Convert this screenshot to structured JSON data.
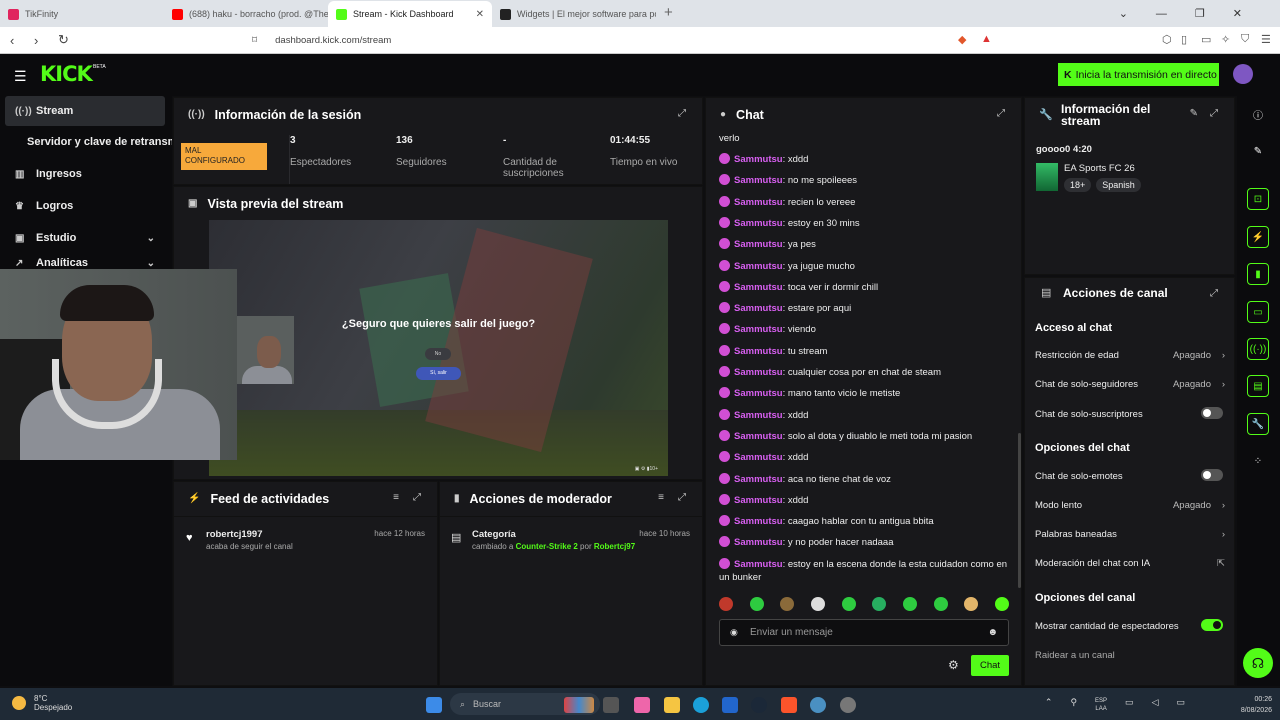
{
  "browser": {
    "tabs": [
      {
        "title": "TikFinity",
        "color": "#e0245e",
        "active": false
      },
      {
        "title": "(688) haku - borracho (prod. @Theo",
        "color": "#ff0000",
        "active": false
      },
      {
        "title": "Stream - Kick Dashboard",
        "color": "#53fc18",
        "active": true
      },
      {
        "title": "Widgets | El mejor software para po",
        "color": "#222222",
        "active": false
      }
    ],
    "url": "dashboard.kick.com/stream"
  },
  "header": {
    "logo": "KICK",
    "beta": "BETA",
    "go_live": "Inicia la transmisión en directo"
  },
  "sidebar": {
    "items": [
      {
        "label": "Stream",
        "icon": "broadcast-icon"
      },
      {
        "label": "Servidor y clave de retransm",
        "icon": ""
      },
      {
        "label": "Ingresos",
        "icon": "chart-icon"
      },
      {
        "label": "Logros",
        "icon": "trophy-icon"
      },
      {
        "label": "Estudio",
        "icon": "studio-icon"
      },
      {
        "label": "Analíticas",
        "icon": "analytics-icon"
      }
    ]
  },
  "session": {
    "title": "Información de la sesión",
    "badge": "MAL CONFIGURADO",
    "stats": [
      {
        "value": "3",
        "label": "Espectadores"
      },
      {
        "value": "136",
        "label": "Seguidores"
      },
      {
        "value": "-",
        "label": "Cantidad de suscripciones"
      },
      {
        "value": "01:44:55",
        "label": "Tiempo en vivo"
      }
    ]
  },
  "preview": {
    "title": "Vista previa del stream",
    "dialog": "¿Seguro que quieres salir del juego?",
    "no": "No",
    "yes": "Sí, salir"
  },
  "feed": {
    "title": "Feed de actividades",
    "item": {
      "name": "robertcj1997",
      "action": "acaba de seguir el canal",
      "time": "hace 12 horas"
    }
  },
  "mod": {
    "title": "Acciones de moderador",
    "item": {
      "name": "Categoría",
      "prefix": "cambiado a ",
      "game": "Counter-Strike 2",
      "mid": " por ",
      "user": "Robertcj97",
      "time": "hace 10 horas"
    }
  },
  "chat": {
    "title": "Chat",
    "first": "verlo",
    "messages": [
      {
        "user": "Sammutsu",
        "text": "xddd"
      },
      {
        "user": "Sammutsu",
        "text": "no me spoileees"
      },
      {
        "user": "Sammutsu",
        "text": "recien lo vereee"
      },
      {
        "user": "Sammutsu",
        "text": "estoy en 30 mins"
      },
      {
        "user": "Sammutsu",
        "text": "ya pes"
      },
      {
        "user": "Sammutsu",
        "text": "ya jugue mucho"
      },
      {
        "user": "Sammutsu",
        "text": "toca ver ir dormir chill"
      },
      {
        "user": "Sammutsu",
        "text": "estare por aqui"
      },
      {
        "user": "Sammutsu",
        "text": "viendo"
      },
      {
        "user": "Sammutsu",
        "text": "tu stream"
      },
      {
        "user": "Sammutsu",
        "text": "cualquier cosa por en chat de steam"
      },
      {
        "user": "Sammutsu",
        "text": "mano tanto vicio le metiste"
      },
      {
        "user": "Sammutsu",
        "text": "xddd"
      },
      {
        "user": "Sammutsu",
        "text": "solo al dota y diuablo le meti toda mi pasion"
      },
      {
        "user": "Sammutsu",
        "text": "xddd"
      },
      {
        "user": "Sammutsu",
        "text": "aca no tiene chat de voz"
      },
      {
        "user": "Sammutsu",
        "text": "xddd"
      },
      {
        "user": "Sammutsu",
        "text": "caagao hablar con tu antigua bbita"
      },
      {
        "user": "Sammutsu",
        "text": "y no poder hacer nadaaa"
      },
      {
        "user": "Sammutsu",
        "text": "estoy en la escena donde la esta cuidadon como en un bunker"
      }
    ],
    "placeholder": "Enviar un mensaje",
    "send": "Chat"
  },
  "stream_info": {
    "title": "Información del stream",
    "stream_title": "goooo0 4:20",
    "category": "EA Sports FC 26",
    "tags": [
      "18+",
      "Spanish"
    ]
  },
  "channel": {
    "title": "Acciones de canal",
    "chat_access": "Acceso al chat",
    "age": {
      "label": "Restricción de edad",
      "value": "Apagado"
    },
    "followers": {
      "label": "Chat de solo-seguidores",
      "value": "Apagado"
    },
    "subs": {
      "label": "Chat de solo-suscriptores"
    },
    "chat_options": "Opciones del chat",
    "emotes": {
      "label": "Chat de solo-emotes"
    },
    "slow": {
      "label": "Modo lento",
      "value": "Apagado"
    },
    "banned": {
      "label": "Palabras baneadas"
    },
    "ai": {
      "label": "Moderación del chat con IA"
    },
    "channel_options": "Opciones del canal",
    "viewers": {
      "label": "Mostrar cantidad de espectadores"
    },
    "raid": {
      "label": "Raidear a un canal"
    }
  },
  "taskbar": {
    "temp": "8°C",
    "weather": "Despejado",
    "search": "Buscar",
    "lang1": "ESP",
    "lang2": "LAA",
    "time": "00:26",
    "date": "8/08/2026"
  }
}
